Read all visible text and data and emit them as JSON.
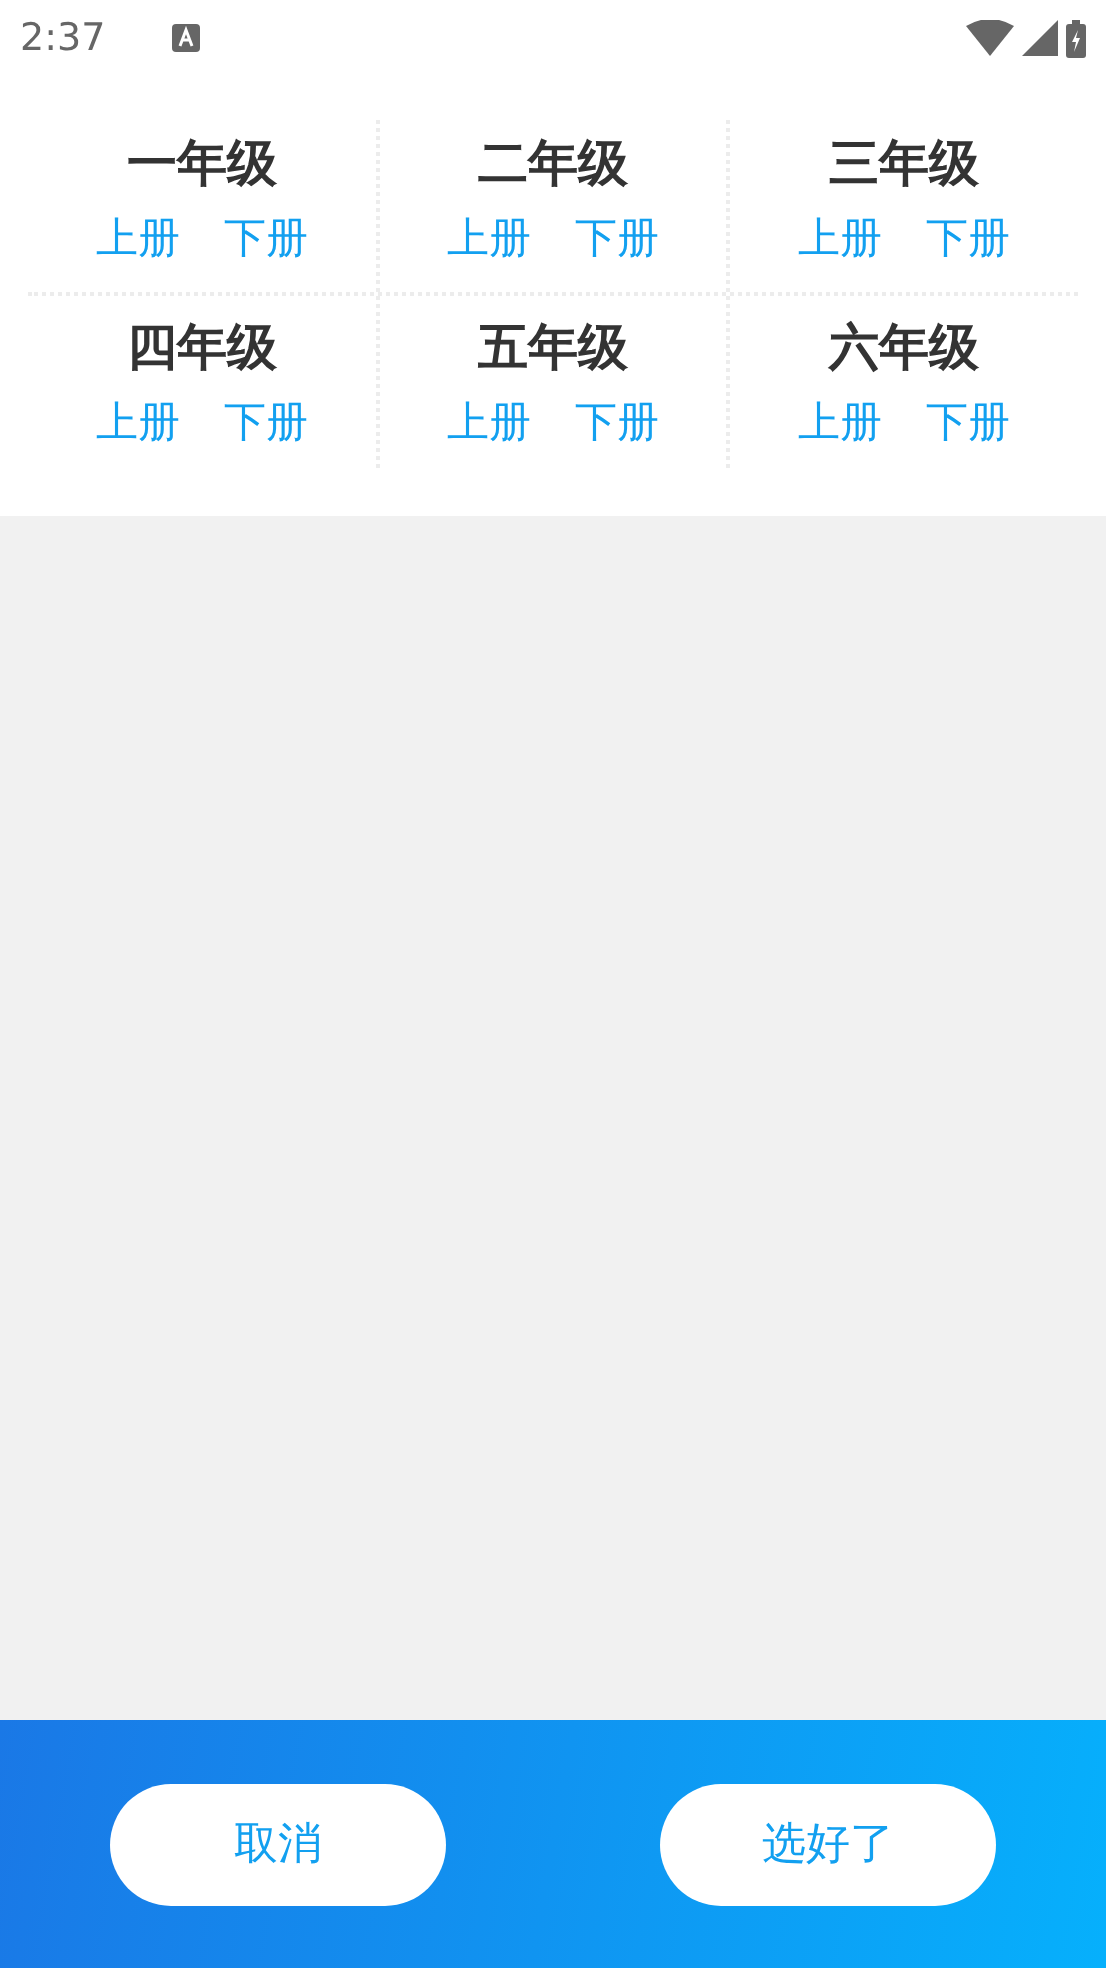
{
  "status_bar": {
    "time": "2:37"
  },
  "grades": [
    {
      "title": "一年级",
      "volumes": [
        "上册",
        "下册"
      ]
    },
    {
      "title": "二年级",
      "volumes": [
        "上册",
        "下册"
      ]
    },
    {
      "title": "三年级",
      "volumes": [
        "上册",
        "下册"
      ]
    },
    {
      "title": "四年级",
      "volumes": [
        "上册",
        "下册"
      ]
    },
    {
      "title": "五年级",
      "volumes": [
        "上册",
        "下册"
      ]
    },
    {
      "title": "六年级",
      "volumes": [
        "上册",
        "下册"
      ]
    }
  ],
  "buttons": [
    "取消",
    "选好了"
  ]
}
